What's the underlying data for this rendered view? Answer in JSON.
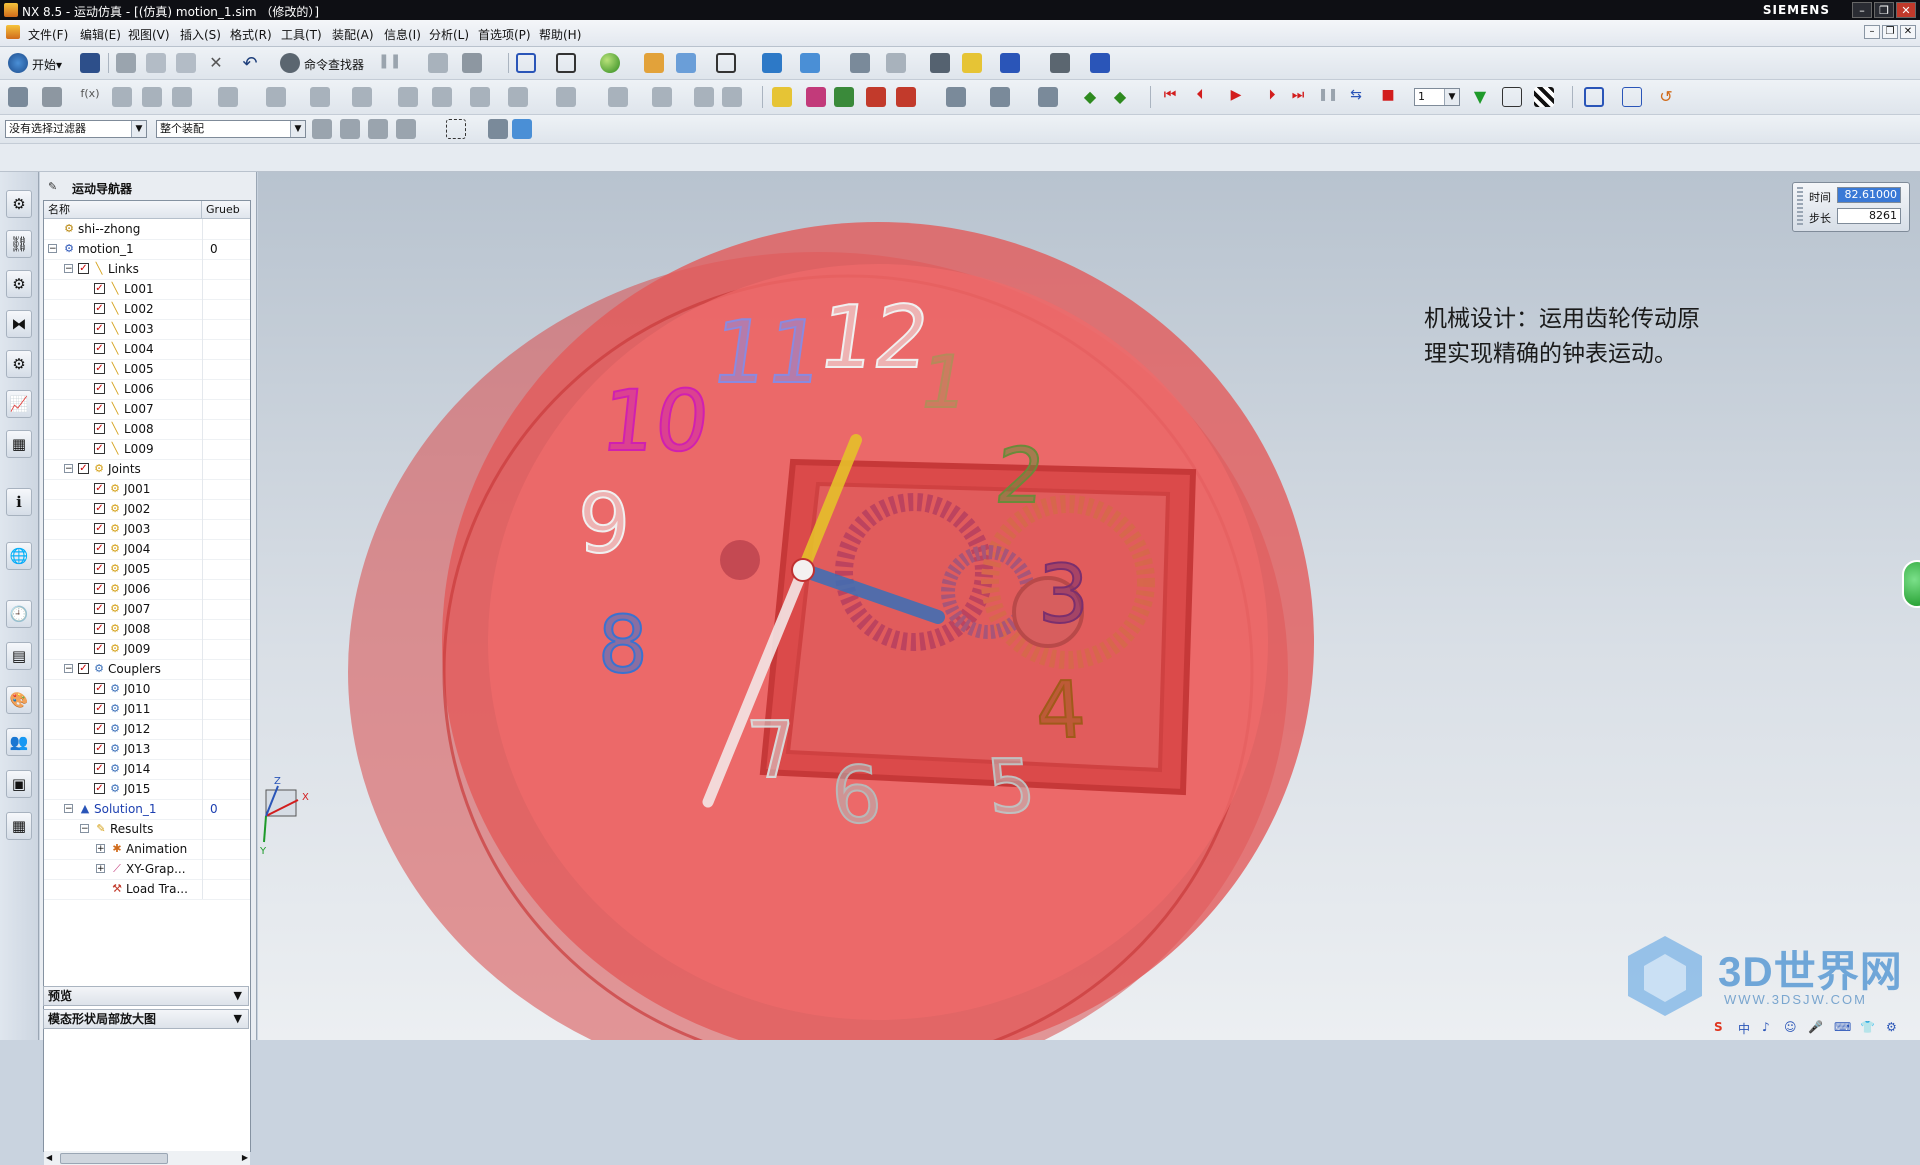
{
  "window": {
    "title": "NX 8.5 - 运动仿真 - [(仿真) motion_1.sim （修改的）]",
    "brand": "SIEMENS",
    "controls": {
      "minimize": "–",
      "restore": "❐",
      "close": "✕"
    }
  },
  "menu": [
    "文件(F)",
    "编辑(E)",
    "视图(V)",
    "插入(S)",
    "格式(R)",
    "工具(T)",
    "装配(A)",
    "信息(I)",
    "分析(L)",
    "首选项(P)",
    "帮助(H)"
  ],
  "toolbar1": {
    "start_label": "开始▾",
    "command_finder_label": "命令查找器"
  },
  "toolbar2": {
    "step_value": "1"
  },
  "filters": {
    "selection_filter": "没有选择过滤器",
    "scope": "整个装配"
  },
  "navigator": {
    "title": "运动导航器",
    "columns": [
      "名称",
      "Grueb"
    ],
    "rows": [
      {
        "label": "shi--zhong",
        "value": "",
        "level": 0,
        "expander": "",
        "check": false,
        "icon": "part-icon"
      },
      {
        "label": "motion_1",
        "value": "0",
        "level": 0,
        "expander": "⊟",
        "check": false,
        "icon": "motion-icon"
      },
      {
        "label": "Links",
        "value": "",
        "level": 1,
        "expander": "⊟",
        "check": true,
        "icon": "link-icon"
      },
      {
        "label": "L001",
        "value": "",
        "level": 2,
        "expander": "",
        "check": true,
        "icon": "link-icon"
      },
      {
        "label": "L002",
        "value": "",
        "level": 2,
        "expander": "",
        "check": true,
        "icon": "link-icon"
      },
      {
        "label": "L003",
        "value": "",
        "level": 2,
        "expander": "",
        "check": true,
        "icon": "link-icon"
      },
      {
        "label": "L004",
        "value": "",
        "level": 2,
        "expander": "",
        "check": true,
        "icon": "link-icon"
      },
      {
        "label": "L005",
        "value": "",
        "level": 2,
        "expander": "",
        "check": true,
        "icon": "link-icon"
      },
      {
        "label": "L006",
        "value": "",
        "level": 2,
        "expander": "",
        "check": true,
        "icon": "link-icon"
      },
      {
        "label": "L007",
        "value": "",
        "level": 2,
        "expander": "",
        "check": true,
        "icon": "link-icon"
      },
      {
        "label": "L008",
        "value": "",
        "level": 2,
        "expander": "",
        "check": true,
        "icon": "link-icon"
      },
      {
        "label": "L009",
        "value": "",
        "level": 2,
        "expander": "",
        "check": true,
        "icon": "link-icon"
      },
      {
        "label": "Joints",
        "value": "",
        "level": 1,
        "expander": "⊟",
        "check": true,
        "icon": "joint-icon"
      },
      {
        "label": "J001",
        "value": "",
        "level": 2,
        "expander": "",
        "check": true,
        "icon": "joint-icon"
      },
      {
        "label": "J002",
        "value": "",
        "level": 2,
        "expander": "",
        "check": true,
        "icon": "joint-icon"
      },
      {
        "label": "J003",
        "value": "",
        "level": 2,
        "expander": "",
        "check": true,
        "icon": "joint-icon"
      },
      {
        "label": "J004",
        "value": "",
        "level": 2,
        "expander": "",
        "check": true,
        "icon": "joint-icon"
      },
      {
        "label": "J005",
        "value": "",
        "level": 2,
        "expander": "",
        "check": true,
        "icon": "joint-icon"
      },
      {
        "label": "J006",
        "value": "",
        "level": 2,
        "expander": "",
        "check": true,
        "icon": "joint-icon"
      },
      {
        "label": "J007",
        "value": "",
        "level": 2,
        "expander": "",
        "check": true,
        "icon": "joint-icon"
      },
      {
        "label": "J008",
        "value": "",
        "level": 2,
        "expander": "",
        "check": true,
        "icon": "joint-icon"
      },
      {
        "label": "J009",
        "value": "",
        "level": 2,
        "expander": "",
        "check": true,
        "icon": "joint-icon"
      },
      {
        "label": "Couplers",
        "value": "",
        "level": 1,
        "expander": "⊟",
        "check": true,
        "icon": "coupler-icon"
      },
      {
        "label": "J010",
        "value": "",
        "level": 2,
        "expander": "",
        "check": true,
        "icon": "coupler-icon"
      },
      {
        "label": "J011",
        "value": "",
        "level": 2,
        "expander": "",
        "check": true,
        "icon": "coupler-icon"
      },
      {
        "label": "J012",
        "value": "",
        "level": 2,
        "expander": "",
        "check": true,
        "icon": "coupler-icon"
      },
      {
        "label": "J013",
        "value": "",
        "level": 2,
        "expander": "",
        "check": true,
        "icon": "coupler-icon"
      },
      {
        "label": "J014",
        "value": "",
        "level": 2,
        "expander": "",
        "check": true,
        "icon": "coupler-icon"
      },
      {
        "label": "J015",
        "value": "",
        "level": 2,
        "expander": "",
        "check": true,
        "icon": "coupler-icon"
      },
      {
        "label": "Solution_1",
        "value": "0",
        "level": 1,
        "expander": "⊟",
        "check": false,
        "icon": "solution-icon",
        "highlight": true
      },
      {
        "label": "Results",
        "value": "",
        "level": 2,
        "expander": "⊟",
        "check": false,
        "icon": "results-icon"
      },
      {
        "label": "Animation",
        "value": "",
        "level": 3,
        "expander": "⊞",
        "check": false,
        "icon": "animation-icon"
      },
      {
        "label": "XY-Grap...",
        "value": "",
        "level": 3,
        "expander": "⊞",
        "check": false,
        "icon": "graph-icon"
      },
      {
        "label": "Load Tra...",
        "value": "",
        "level": 3,
        "expander": "",
        "check": false,
        "icon": "load-transfer-icon"
      }
    ],
    "preview_label": "预览",
    "modal_label": "模态形状局部放大图"
  },
  "timebox": {
    "time_label": "时间",
    "time_value": "82.61000",
    "step_label": "步长",
    "step_value": "8261"
  },
  "caption": "机械设计：运用齿轮传动原理实现精确的钟表运动。",
  "clock": {
    "numbers": [
      "12",
      "1",
      "2",
      "3",
      "4",
      "5",
      "6",
      "7",
      "8",
      "9",
      "10",
      "11"
    ],
    "number_colors": [
      "#f0f0f0",
      "#b58a5a",
      "#6b8a3a",
      "#7a2f6e",
      "#a05a1a",
      "#c0c0c0",
      "#b8b8b8",
      "#d8d8d8",
      "#3a72d0",
      "#f0f0f0",
      "#d020b0",
      "#8a8ae0"
    ]
  },
  "watermark": {
    "main": "3D世界网",
    "sub": "WWW.3DSJW.COM"
  },
  "taskbar": {
    "items": [
      "S",
      "中",
      "♪",
      "☺",
      "🎤",
      "⌨",
      "👕",
      "⚙"
    ]
  },
  "axes": {
    "x": "X",
    "y": "Y",
    "z": "Z"
  }
}
